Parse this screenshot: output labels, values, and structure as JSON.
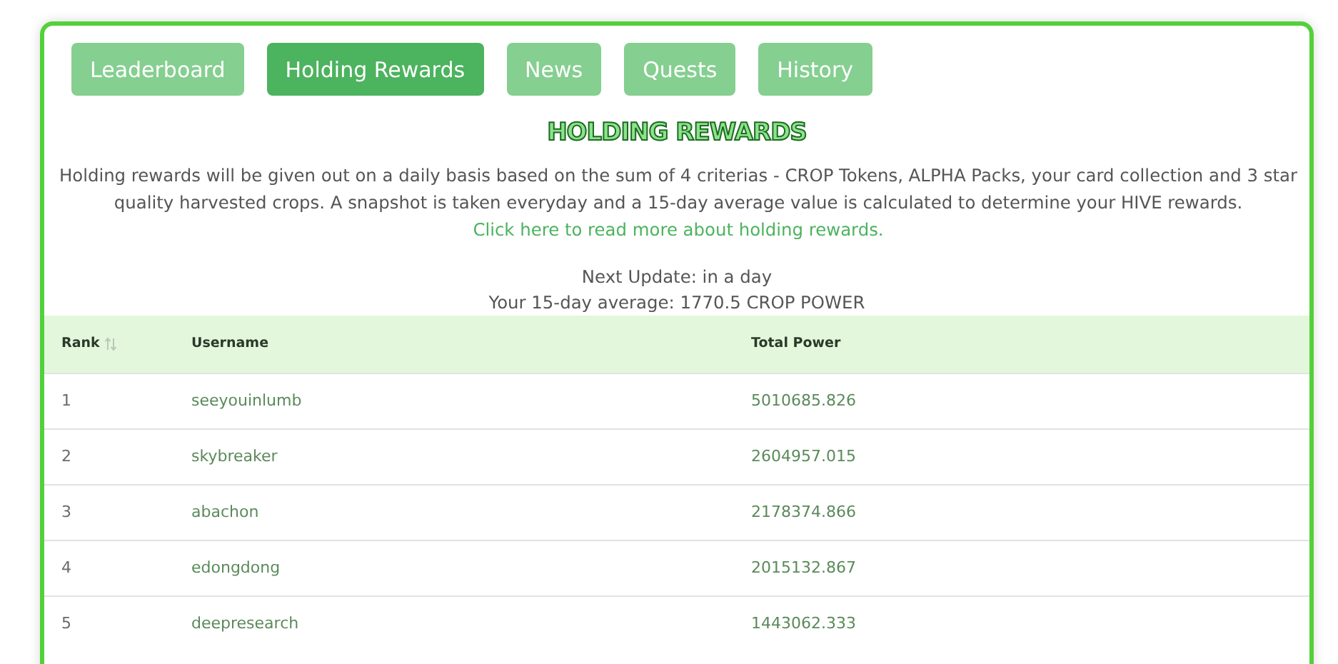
{
  "tabs": [
    {
      "label": "Leaderboard",
      "selected": false
    },
    {
      "label": "Holding Rewards",
      "selected": true
    },
    {
      "label": "News",
      "selected": false
    },
    {
      "label": "Quests",
      "selected": false
    },
    {
      "label": "History",
      "selected": false
    }
  ],
  "title": "HOLDING REWARDS",
  "description": "Holding rewards will be given out on a daily basis based on the sum of 4 criterias - CROP Tokens, ALPHA Packs, your card collection and 3 star quality harvested crops. A snapshot is taken everyday and a 15-day average value is calculated to determine your HIVE rewards.",
  "description_link": "Click here to read more about holding rewards.",
  "next_update": "Next Update: in a day",
  "average": "Your 15-day average: 1770.5 CROP POWER",
  "table": {
    "columns": [
      "Rank",
      "Username",
      "Total Power"
    ],
    "rows": [
      [
        "1",
        "seeyouinlumb",
        "5010685.826"
      ],
      [
        "2",
        "skybreaker",
        "2604957.015"
      ],
      [
        "3",
        "abachon",
        "2178374.866"
      ],
      [
        "4",
        "edongdong",
        "2015132.867"
      ],
      [
        "5",
        "deepresearch",
        "1443062.333"
      ]
    ]
  }
}
